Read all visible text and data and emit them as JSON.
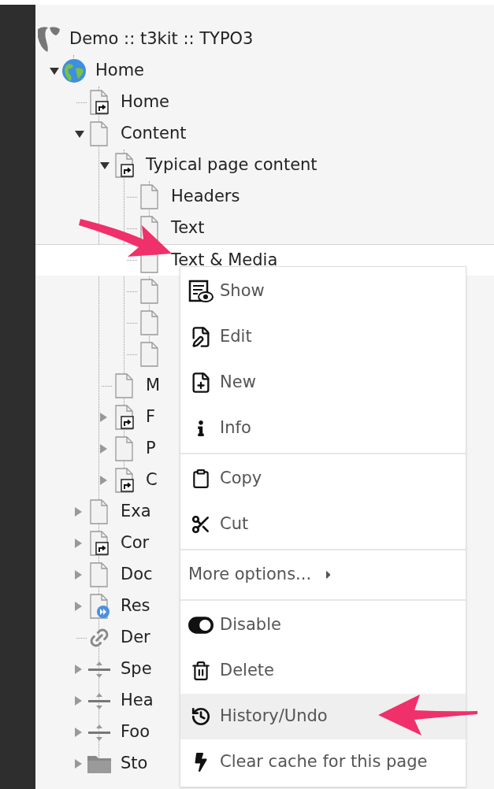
{
  "tree": {
    "label": "Demo :: t3kit :: TYPO3",
    "kind": "logo",
    "selected": false,
    "children": [
      {
        "label": "Home",
        "kind": "globe",
        "expanded": true,
        "selected": false,
        "children": [
          {
            "label": "Home",
            "kind": "shortcut",
            "selected": false
          },
          {
            "label": "Content",
            "kind": "page",
            "expanded": true,
            "selected": false,
            "children": [
              {
                "label": "Typical page content",
                "kind": "shortcut",
                "expanded": true,
                "selected": false,
                "children": [
                  {
                    "label": "Headers",
                    "kind": "page",
                    "selected": false
                  },
                  {
                    "label": "Text",
                    "kind": "page",
                    "selected": false
                  },
                  {
                    "label": "Text & Media",
                    "kind": "page",
                    "selected": true
                  },
                  {
                    "kind": "page",
                    "selected": false
                  },
                  {
                    "kind": "page",
                    "selected": false
                  },
                  {
                    "kind": "page",
                    "selected": false
                  }
                ]
              },
              {
                "label": "M",
                "kind": "page",
                "selected": false
              },
              {
                "label": "F",
                "kind": "shortcut",
                "expanded": false,
                "selected": false
              },
              {
                "label": "P",
                "kind": "page",
                "expanded": false,
                "selected": false
              },
              {
                "label": "C",
                "kind": "shortcut",
                "expanded": false,
                "selected": false
              }
            ]
          },
          {
            "label": "Exa",
            "kind": "page",
            "expanded": false,
            "selected": false
          },
          {
            "label": "Cor",
            "kind": "shortcut",
            "expanded": false,
            "selected": false
          },
          {
            "label": "Doc",
            "kind": "page",
            "expanded": false,
            "selected": false
          },
          {
            "label": "Res",
            "kind": "mount",
            "expanded": false,
            "selected": false
          },
          {
            "label": "Der",
            "kind": "link",
            "selected": false
          },
          {
            "label": "Spe",
            "kind": "separator",
            "expanded": false,
            "selected": false
          },
          {
            "label": "Hea",
            "kind": "separator",
            "expanded": false,
            "selected": false
          },
          {
            "label": "Foo",
            "kind": "separator",
            "expanded": false,
            "selected": false
          },
          {
            "label": "Sto",
            "kind": "folder",
            "expanded": false,
            "selected": false
          }
        ]
      }
    ]
  },
  "context_menu": {
    "groups": [
      [
        {
          "label": "Show",
          "kind": "show",
          "selected": false
        },
        {
          "label": "Edit",
          "kind": "edit",
          "selected": false
        },
        {
          "label": "New",
          "kind": "new",
          "selected": false
        },
        {
          "label": "Info",
          "kind": "info",
          "selected": false
        }
      ],
      [
        {
          "label": "Copy",
          "kind": "copy",
          "selected": false
        },
        {
          "label": "Cut",
          "kind": "cut",
          "selected": false
        }
      ],
      [
        {
          "label": "More options...",
          "kind": "submenu",
          "selected": false
        }
      ],
      [
        {
          "label": "Disable",
          "kind": "disable",
          "selected": false
        },
        {
          "label": "Delete",
          "kind": "delete",
          "selected": false
        },
        {
          "label": "History/Undo",
          "kind": "history",
          "selected": true
        },
        {
          "label": "Clear cache for this page",
          "kind": "flash",
          "selected": false
        }
      ]
    ]
  }
}
